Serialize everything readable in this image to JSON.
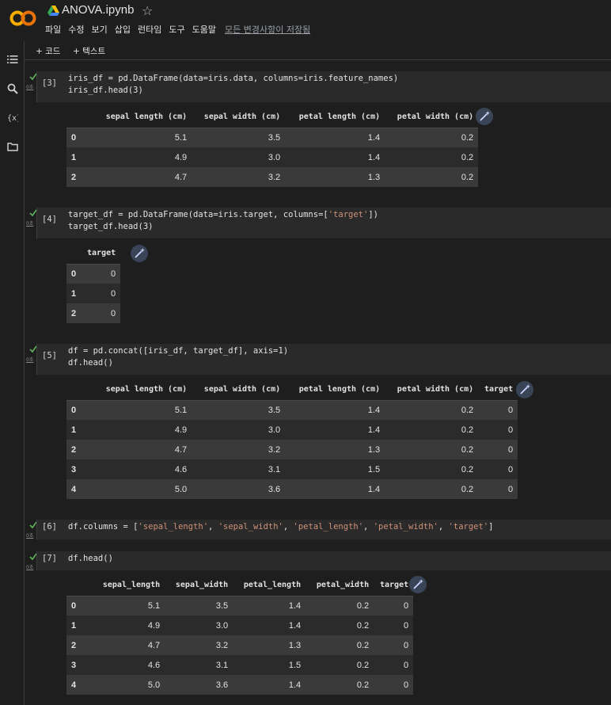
{
  "header": {
    "title": "ANOVA.ipynb",
    "menu": [
      "파일",
      "수정",
      "보기",
      "삽입",
      "런타임",
      "도구",
      "도움말"
    ],
    "saved_status": "모든 변경사항이 저장됨"
  },
  "toolbar": {
    "code_label": "+ 코드",
    "text_label": "+ 텍스트"
  },
  "cells": [
    {
      "number": "[3]",
      "exec_time": "0초",
      "lines": [
        "iris_df = pd.DataFrame(data=iris.data, columns=iris.feature_names)",
        "iris_df.head(3)"
      ],
      "table": {
        "columns": [
          "sepal length (cm)",
          "sepal width (cm)",
          "petal length (cm)",
          "petal width (cm)"
        ],
        "rows": [
          [
            "0",
            "5.1",
            "3.5",
            "1.4",
            "0.2"
          ],
          [
            "1",
            "4.9",
            "3.0",
            "1.4",
            "0.2"
          ],
          [
            "2",
            "4.7",
            "3.2",
            "1.3",
            "0.2"
          ]
        ]
      }
    },
    {
      "number": "[4]",
      "exec_time": "0초",
      "lines": [
        "target_df = pd.DataFrame(data=iris.target, columns=['target'])",
        "target_df.head(3)"
      ],
      "table": {
        "columns": [
          "target"
        ],
        "rows": [
          [
            "0",
            "0"
          ],
          [
            "1",
            "0"
          ],
          [
            "2",
            "0"
          ]
        ]
      }
    },
    {
      "number": "[5]",
      "exec_time": "0초",
      "lines": [
        "df = pd.concat([iris_df, target_df], axis=1)",
        "df.head()"
      ],
      "table": {
        "columns": [
          "sepal length (cm)",
          "sepal width (cm)",
          "petal length (cm)",
          "petal width (cm)",
          "target"
        ],
        "rows": [
          [
            "0",
            "5.1",
            "3.5",
            "1.4",
            "0.2",
            "0"
          ],
          [
            "1",
            "4.9",
            "3.0",
            "1.4",
            "0.2",
            "0"
          ],
          [
            "2",
            "4.7",
            "3.2",
            "1.3",
            "0.2",
            "0"
          ],
          [
            "3",
            "4.6",
            "3.1",
            "1.5",
            "0.2",
            "0"
          ],
          [
            "4",
            "5.0",
            "3.6",
            "1.4",
            "0.2",
            "0"
          ]
        ]
      }
    },
    {
      "number": "[6]",
      "exec_time": "0초",
      "lines": [
        "df.columns = ['sepal_length', 'sepal_width', 'petal_length', 'petal_width', 'target']"
      ]
    },
    {
      "number": "[7]",
      "exec_time": "0초",
      "lines": [
        "df.head()"
      ],
      "table": {
        "columns": [
          "sepal_length",
          "sepal_width",
          "petal_length",
          "petal_width",
          "target"
        ],
        "rows": [
          [
            "0",
            "5.1",
            "3.5",
            "1.4",
            "0.2",
            "0"
          ],
          [
            "1",
            "4.9",
            "3.0",
            "1.4",
            "0.2",
            "0"
          ],
          [
            "2",
            "4.7",
            "3.2",
            "1.3",
            "0.2",
            "0"
          ],
          [
            "3",
            "4.6",
            "3.1",
            "1.5",
            "0.2",
            "0"
          ],
          [
            "4",
            "5.0",
            "3.6",
            "1.4",
            "0.2",
            "0"
          ]
        ]
      }
    }
  ],
  "colors": {
    "accent_green": "#5fb35f",
    "string": "#ce9178",
    "logo_orange": "#f9ab00",
    "wand_bg": "#394457"
  }
}
